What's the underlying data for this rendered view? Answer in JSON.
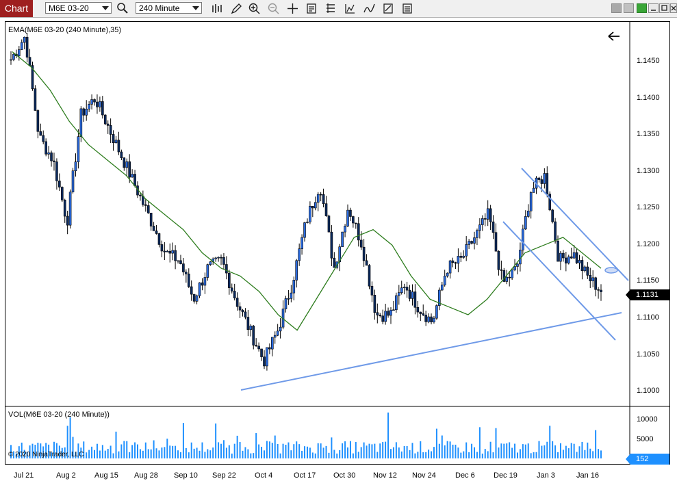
{
  "toolbar": {
    "chart_tab": "Chart",
    "instrument": "M6E 03-20",
    "interval": "240 Minute"
  },
  "icons": [
    "bar-type-icon",
    "draw-pencil-icon",
    "zoom-in-icon",
    "zoom-out-icon",
    "crosshair-icon",
    "data-box-icon",
    "drawing-objects-icon",
    "strategy-icon",
    "indicator-icon",
    "properties-icon",
    "tab-overflow-icon"
  ],
  "panels": {
    "price_label": "EMA(M6E 03-20 (240 Minute),35)",
    "volume_label": "VOL(M6E 03-20 (240 Minute))",
    "copyright": "© 2020 NinjaTrader, LLC"
  },
  "price_axis": {
    "ticks": [
      "1.1450",
      "1.1400",
      "1.1350",
      "1.1300",
      "1.1250",
      "1.1200",
      "1.1150",
      "1.1100",
      "1.1050",
      "1.1000"
    ],
    "current_price": "1.1131",
    "current_volume": "152"
  },
  "volume_axis": {
    "ticks": [
      "10000",
      "5000"
    ]
  },
  "time_axis": {
    "ticks": [
      "Jul 21",
      "Aug 2",
      "Aug 15",
      "Aug 28",
      "Sep 10",
      "Sep 22",
      "Oct 4",
      "Oct 17",
      "Oct 30",
      "Nov 12",
      "Nov 24",
      "Dec 6",
      "Dec 19",
      "Jan 3",
      "Jan 16"
    ]
  },
  "colors": {
    "tab": "#9e1f1f",
    "ema": "#2e7d1e",
    "trendline": "#6f9ae8",
    "volume": "#1e90ff",
    "price_tag": "#000000",
    "volume_tag": "#1e90ff"
  },
  "chart_data": {
    "type": "candlestick",
    "series": [
      {
        "name": "M6E 03-20 (240 Minute)",
        "close_approx": [
          1.143,
          1.146,
          1.133,
          1.13,
          1.122,
          1.136,
          1.138,
          1.134,
          1.13,
          1.126,
          1.122,
          1.118,
          1.117,
          1.112,
          1.116,
          1.117,
          1.112,
          1.108,
          1.104,
          1.108,
          1.114,
          1.122,
          1.127,
          1.116,
          1.124,
          1.119,
          1.11,
          1.11,
          1.114,
          1.111,
          1.109,
          1.116,
          1.117,
          1.12,
          1.123,
          1.114,
          1.116,
          1.126,
          1.128,
          1.117,
          1.118,
          1.115,
          1.1131
        ]
      },
      {
        "name": "EMA(35)",
        "values_approx": [
          1.144,
          1.142,
          1.139,
          1.135,
          1.132,
          1.13,
          1.128,
          1.125,
          1.123,
          1.121,
          1.118,
          1.116,
          1.115,
          1.113,
          1.11,
          1.108,
          1.112,
          1.116,
          1.12,
          1.121,
          1.119,
          1.115,
          1.112,
          1.111,
          1.11,
          1.112,
          1.115,
          1.118,
          1.119,
          1.12,
          1.118,
          1.116
        ]
      }
    ],
    "volume": {
      "name": "VOL(M6E 03-20 (240 Minute))",
      "last": 152,
      "ylim": [
        0,
        12000
      ]
    },
    "ylim": [
      1.0985,
      1.1475
    ],
    "x_categories": [
      "Jul 21",
      "Aug 2",
      "Aug 15",
      "Aug 28",
      "Sep 10",
      "Sep 22",
      "Oct 4",
      "Oct 17",
      "Oct 30",
      "Nov 12",
      "Nov 24",
      "Dec 6",
      "Dec 19",
      "Jan 3",
      "Jan 16"
    ]
  }
}
